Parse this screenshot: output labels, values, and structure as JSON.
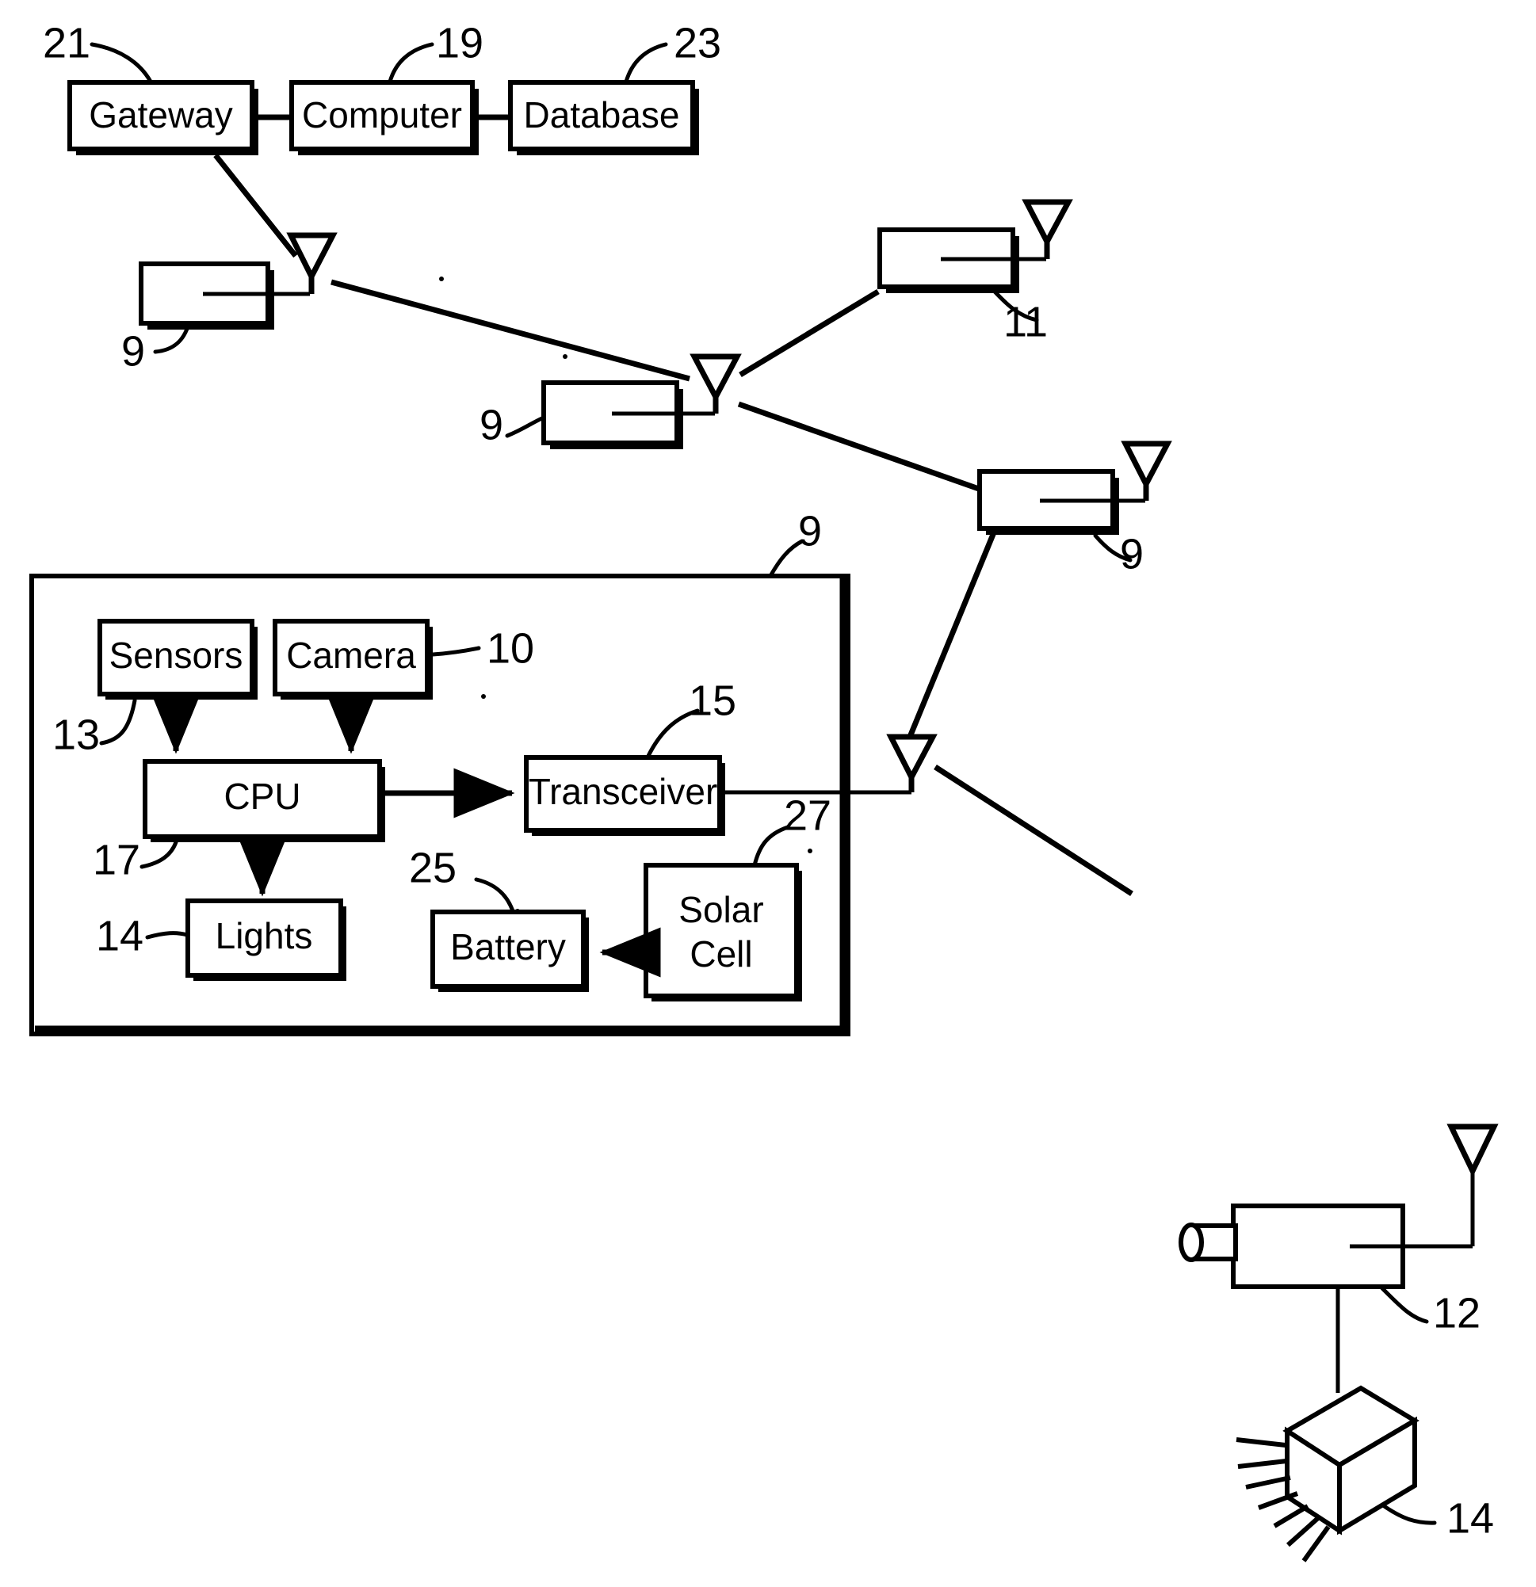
{
  "figure": {
    "title": "Wireless sensor network block diagram",
    "background_color": "#ffffff",
    "line_color": "#000000"
  },
  "backhaul": {
    "boxes": [
      {
        "label": "Gateway",
        "ref": "21"
      },
      {
        "label": "Computer",
        "ref": "19"
      },
      {
        "label": "Database",
        "ref": "23"
      }
    ]
  },
  "network_nodes": [
    {
      "ref": "9",
      "name": "sensor-node-upper-left"
    },
    {
      "ref": "9",
      "name": "sensor-node-center"
    },
    {
      "ref": "11",
      "name": "sensor-node-upper-right"
    },
    {
      "ref": "9",
      "name": "sensor-node-right"
    },
    {
      "ref": "9",
      "name": "sensor-node-detail"
    }
  ],
  "detail_node": {
    "ref": "9",
    "blocks": [
      {
        "label": "Sensors",
        "ref": "13"
      },
      {
        "label": "Camera",
        "ref": "10"
      },
      {
        "label": "CPU",
        "ref": "17"
      },
      {
        "label": "Transceiver",
        "ref": "15"
      },
      {
        "label": "Lights",
        "ref": "14"
      },
      {
        "label": "Battery",
        "ref": "25"
      },
      {
        "label": "Solar",
        "label2": "Cell",
        "ref": "27"
      }
    ]
  },
  "field_devices": [
    {
      "ref": "12",
      "name": "camera-device"
    },
    {
      "ref": "14",
      "name": "light-fixture"
    }
  ],
  "ref_numerals": {
    "n9": "9",
    "n10": "10",
    "n11": "11",
    "n12": "12",
    "n13": "13",
    "n14": "14",
    "n15": "15",
    "n17": "17",
    "n19": "19",
    "n21": "21",
    "n23": "23",
    "n25": "25",
    "n27": "27"
  },
  "labels": {
    "gateway": "Gateway",
    "computer": "Computer",
    "database": "Database",
    "sensors": "Sensors",
    "camera": "Camera",
    "cpu": "CPU",
    "transceiver": "Transceiver",
    "lights": "Lights",
    "battery": "Battery",
    "solar_line1": "Solar",
    "solar_line2": "Cell"
  }
}
